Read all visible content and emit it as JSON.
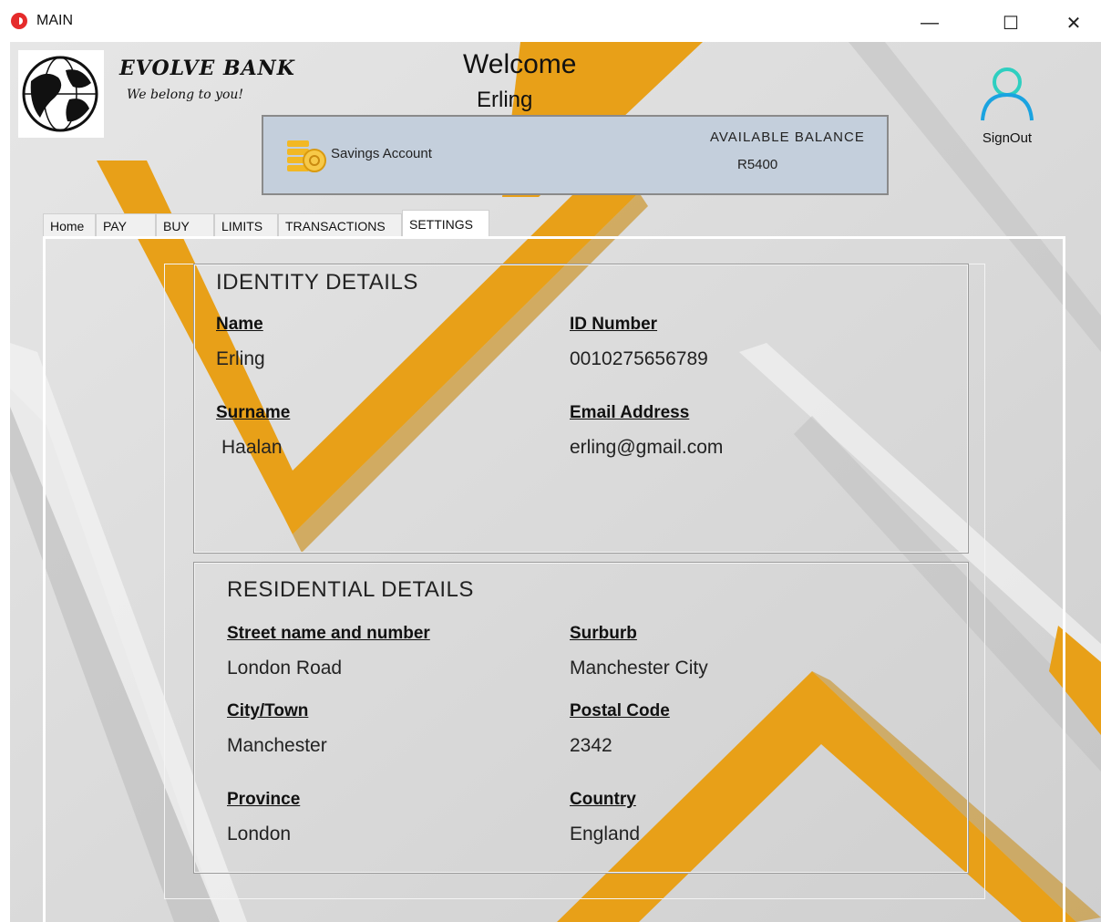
{
  "window": {
    "title": "MAIN",
    "minimize": "—",
    "maximize": "☐",
    "close": "✕"
  },
  "brand": {
    "name": "EVOLVE BANK",
    "slogan": "We belong to you!"
  },
  "welcome": {
    "greeting": "Welcome",
    "user": "Erling"
  },
  "account": {
    "type": "Savings Account",
    "balance_label": "AVAILABLE BALANCE",
    "balance": "R5400"
  },
  "signout": {
    "label": "SignOut",
    "icon": "user-icon"
  },
  "tabs": [
    {
      "label": "Home"
    },
    {
      "label": "PAY"
    },
    {
      "label": "BUY"
    },
    {
      "label": "LIMITS"
    },
    {
      "label": "TRANSACTIONS"
    },
    {
      "label": "SETTINGS",
      "active": true
    }
  ],
  "identity": {
    "title": "IDENTITY DETAILS",
    "name_label": "Name",
    "name_value": "Erling",
    "id_label": "ID Number",
    "id_value": "0010275656789",
    "surname_label": "Surname",
    "surname_value": "Haalan",
    "email_label": "Email Address",
    "email_value": "erling@gmail.com"
  },
  "residential": {
    "title": "RESIDENTIAL DETAILS",
    "street_label": "Street name and number",
    "street_value": "London Road",
    "suburb_label": "Surburb",
    "suburb_value": "Manchester City",
    "city_label": "City/Town",
    "city_value": "Manchester",
    "postal_label": "Postal Code",
    "postal_value": "2342",
    "province_label": "Province",
    "province_value": "London",
    "country_label": "Country",
    "country_value": "England"
  },
  "colors": {
    "accent": "#E8A018",
    "panel": "#C4CFDC",
    "background": "#D9D9D9"
  }
}
